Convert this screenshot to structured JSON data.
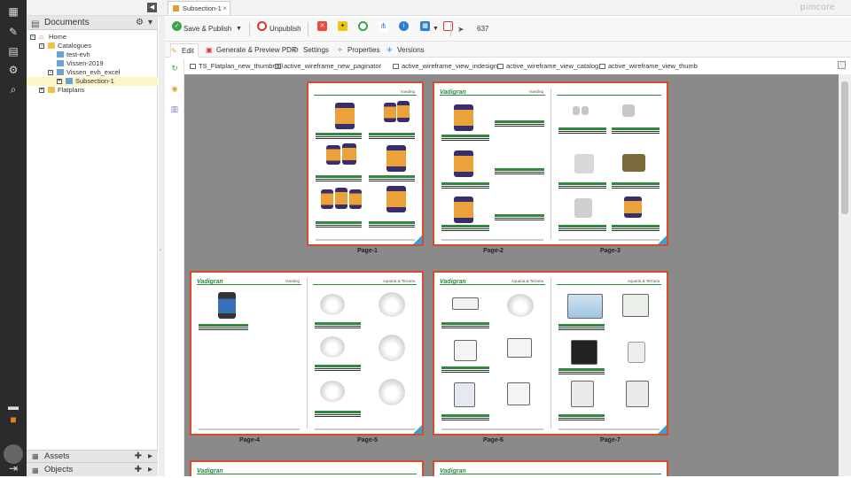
{
  "app": {
    "brand": "pimcore",
    "document_tab": "Subsection-1",
    "object_count": "637"
  },
  "tree": {
    "title": "Documents",
    "items": [
      {
        "label": "Home",
        "level": 0,
        "type": "home",
        "expander": "−"
      },
      {
        "label": "Catalogues",
        "level": 1,
        "type": "folder",
        "expander": "−"
      },
      {
        "label": "test-evh",
        "level": 2,
        "type": "doc",
        "expander": ""
      },
      {
        "label": "Vissen-2019",
        "level": 2,
        "type": "doc",
        "expander": ""
      },
      {
        "label": "Vissen_evh_excel",
        "level": 2,
        "type": "doc",
        "expander": "−"
      },
      {
        "label": "Subsection-1",
        "level": 3,
        "type": "doc",
        "expander": "+",
        "selected": true
      },
      {
        "label": "Flatplans",
        "level": 1,
        "type": "folder",
        "expander": "+"
      }
    ],
    "bottom_panels": [
      {
        "label": "Assets"
      },
      {
        "label": "Objects"
      }
    ]
  },
  "toolbar": {
    "save_publish": "Save & Publish",
    "unpublish": "Unpublish",
    "count": "637"
  },
  "editor_tabs": [
    {
      "label": "Edit",
      "active": true
    },
    {
      "label": "Generate & Preview PDF"
    },
    {
      "label": "Settings"
    },
    {
      "label": "Properties"
    },
    {
      "label": "Versions"
    }
  ],
  "view_tabs": [
    {
      "label": "TS_Flatplan_new_thumbnail"
    },
    {
      "label": "active_wireframe_new_paginator"
    },
    {
      "label": "active_wireframe_view_indesign"
    },
    {
      "label": "active_wireframe_view_catalog"
    },
    {
      "label": "active_wireframe_view_thumb"
    }
  ],
  "pages": [
    {
      "label": "Page-1"
    },
    {
      "label": "Page-2"
    },
    {
      "label": "Page-3"
    },
    {
      "label": "Page-4"
    },
    {
      "label": "Page-5"
    },
    {
      "label": "Page-6"
    },
    {
      "label": "Page-7"
    }
  ],
  "page_header_text": {
    "feeding": "Voeding",
    "aquaria": "Aquaria & Terraria"
  },
  "logo_text": "Vadigran",
  "colors": {
    "accent_green": "#2d8a3e",
    "spread_border": "#d64b2a",
    "canvas_bg": "#8a8a8a",
    "corner_blue": "#3aa0d4"
  }
}
